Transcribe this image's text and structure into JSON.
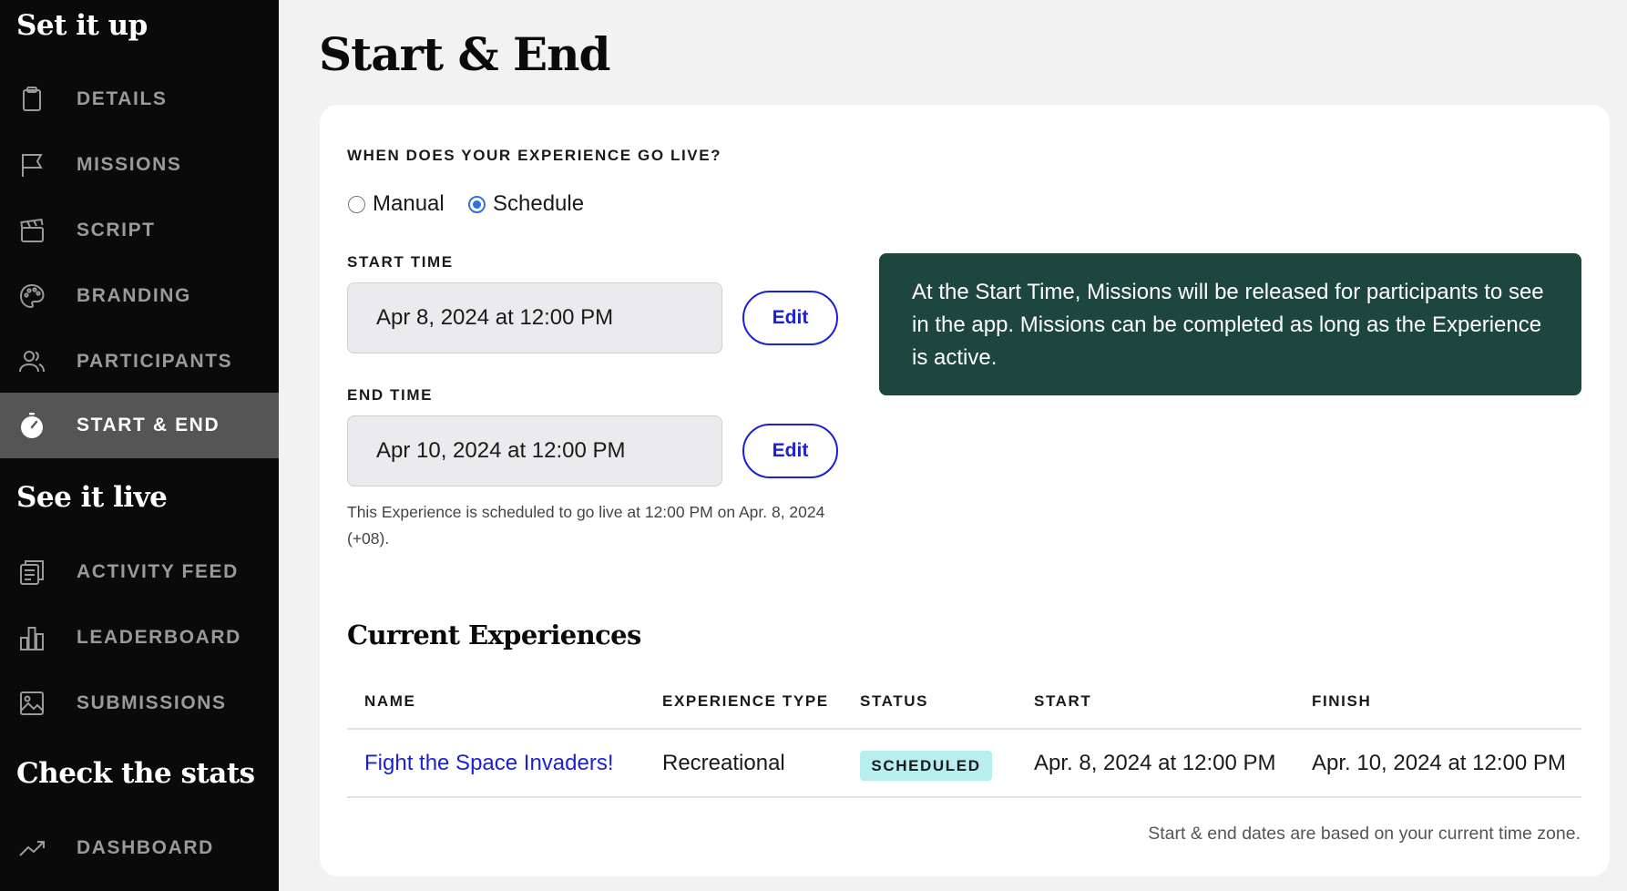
{
  "sidebar": {
    "sections": [
      {
        "title": "Set it up"
      },
      {
        "title": "See it live"
      },
      {
        "title": "Check the stats"
      }
    ],
    "items": [
      {
        "label": "DETAILS",
        "icon": "clipboard-icon"
      },
      {
        "label": "MISSIONS",
        "icon": "flag-icon"
      },
      {
        "label": "SCRIPT",
        "icon": "clapperboard-icon"
      },
      {
        "label": "BRANDING",
        "icon": "palette-icon"
      },
      {
        "label": "PARTICIPANTS",
        "icon": "people-icon"
      },
      {
        "label": "START & END",
        "icon": "stopwatch-icon",
        "active": true
      },
      {
        "label": "ACTIVITY FEED",
        "icon": "feed-icon"
      },
      {
        "label": "LEADERBOARD",
        "icon": "bar-chart-icon"
      },
      {
        "label": "SUBMISSIONS",
        "icon": "image-icon"
      },
      {
        "label": "DASHBOARD",
        "icon": "trend-icon"
      }
    ]
  },
  "main": {
    "title": "Start & End",
    "question": "WHEN DOES YOUR EXPERIENCE GO LIVE?",
    "options": [
      {
        "label": "Manual",
        "checked": false
      },
      {
        "label": "Schedule",
        "checked": true
      }
    ],
    "start": {
      "label": "START TIME",
      "value": "Apr 8, 2024 at 12:00 PM",
      "button": "Edit"
    },
    "end": {
      "label": "END TIME",
      "value": "Apr 10, 2024 at 12:00 PM",
      "button": "Edit"
    },
    "hint": "This Experience is scheduled to go live at 12:00 PM on Apr. 8, 2024 (+08).",
    "info": "At the Start Time, Missions will be released for participants to see in the app. Missions can be completed as long as the Experience is active."
  },
  "experiences": {
    "heading": "Current Experiences",
    "columns": [
      "NAME",
      "EXPERIENCE TYPE",
      "STATUS",
      "START",
      "FINISH"
    ],
    "rows": [
      {
        "name": "Fight the Space Invaders!",
        "type": "Recreational",
        "status": "SCHEDULED",
        "start": "Apr. 8, 2024 at 12:00 PM",
        "finish": "Apr. 10, 2024 at 12:00 PM"
      }
    ],
    "footnote": "Start & end dates are based on your current time zone."
  },
  "colors": {
    "sidebar_bg": "#0a0a0a",
    "active_item_bg": "#555555",
    "accent_blue": "#1b1fd6",
    "info_bg": "#1d473e",
    "badge_bg": "#b8eeee"
  }
}
